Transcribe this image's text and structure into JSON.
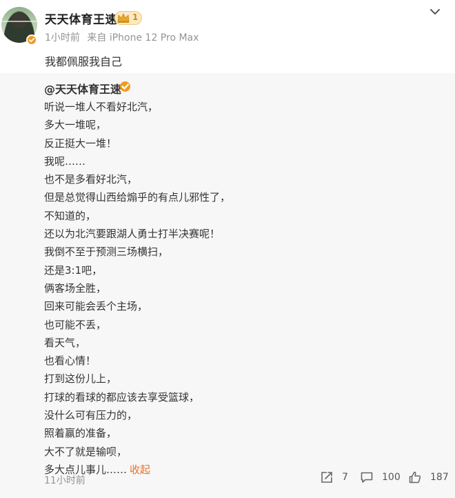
{
  "header": {
    "username": "天天体育王速",
    "vip_level": "1",
    "time": "1小时前",
    "source": "来自 iPhone 12 Pro Max"
  },
  "post": {
    "text": "我都佩服我自己"
  },
  "repost": {
    "author": "@天天体育王速",
    "lines": [
      "听说一堆人不看好北汽，",
      "多大一堆呢，",
      "反正挺大一堆！",
      "我呢……",
      "也不是多看好北汽，",
      "但是总觉得山西给煽乎的有点儿邪性了，",
      "不知道的，",
      "还以为北汽要跟湖人勇士打半决赛呢！",
      "我倒不至于预测三场横扫，",
      "还是3:1吧，",
      "俩客场全胜，",
      "回来可能会丢个主场，",
      "也可能不丢，",
      "看天气，",
      "也看心情！",
      "打到这份儿上，",
      "打球的看球的都应该去享受篮球，",
      "没什么可有压力的，",
      "照着赢的准备，",
      "大不了就是输呗，",
      "多大点儿事儿……"
    ],
    "collapse_label": "收起",
    "time": "11小时前",
    "share_count": "7",
    "comment_count": "100",
    "like_count": "187"
  },
  "colors": {
    "accent_orange": "#e8702a",
    "verify_badge": "#f39a1f",
    "muted_text": "#939393",
    "repost_bg": "#f7f7f7"
  },
  "icons": [
    "verified-icon",
    "vip-crown-icon",
    "chevron-down-icon",
    "share-icon",
    "comment-icon",
    "like-icon"
  ]
}
